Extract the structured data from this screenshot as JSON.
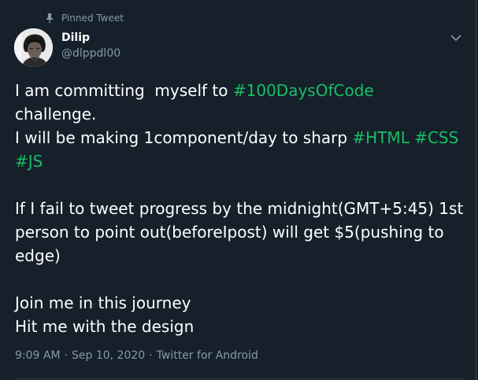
{
  "pinned_label": "Pinned Tweet",
  "author": {
    "name": "Dilip",
    "handle": "@dlppdl00"
  },
  "tweet": {
    "lines": [
      {
        "segments": [
          {
            "text": "I am committing  myself to ",
            "tag": false
          },
          {
            "text": "#100DaysOfCode",
            "tag": true
          }
        ]
      },
      {
        "segments": [
          {
            "text": "challenge.",
            "tag": false
          }
        ]
      },
      {
        "segments": [
          {
            "text": "I will be making 1component/day to sharp ",
            "tag": false
          },
          {
            "text": "#HTML",
            "tag": true
          },
          {
            "text": " ",
            "tag": false
          },
          {
            "text": "#CSS",
            "tag": true
          }
        ]
      },
      {
        "segments": [
          {
            "text": "#JS",
            "tag": true
          }
        ]
      },
      {
        "segments": [
          {
            "text": "",
            "tag": false
          }
        ]
      },
      {
        "segments": [
          {
            "text": "If I fail to tweet progress by the midnight(GMT+5:45) 1st",
            "tag": false
          }
        ]
      },
      {
        "segments": [
          {
            "text": "person to point out(beforeIpost) will get $5(pushing to",
            "tag": false
          }
        ]
      },
      {
        "segments": [
          {
            "text": "edge)",
            "tag": false
          }
        ]
      },
      {
        "segments": [
          {
            "text": "",
            "tag": false
          }
        ]
      },
      {
        "segments": [
          {
            "text": "Join me in this journey",
            "tag": false
          }
        ]
      },
      {
        "segments": [
          {
            "text": "Hit me with the design",
            "tag": false
          }
        ]
      }
    ]
  },
  "meta": {
    "time": "9:09 AM",
    "date": "Sep 10, 2020",
    "source": "Twitter for Android",
    "sep1": "·",
    "sep2": "·"
  },
  "colors": {
    "background": "#15202b",
    "hashtag": "#17bf63",
    "secondary_text": "#8899a6"
  },
  "icons": {
    "pin": "pin-icon",
    "more": "chevron-down-icon"
  }
}
